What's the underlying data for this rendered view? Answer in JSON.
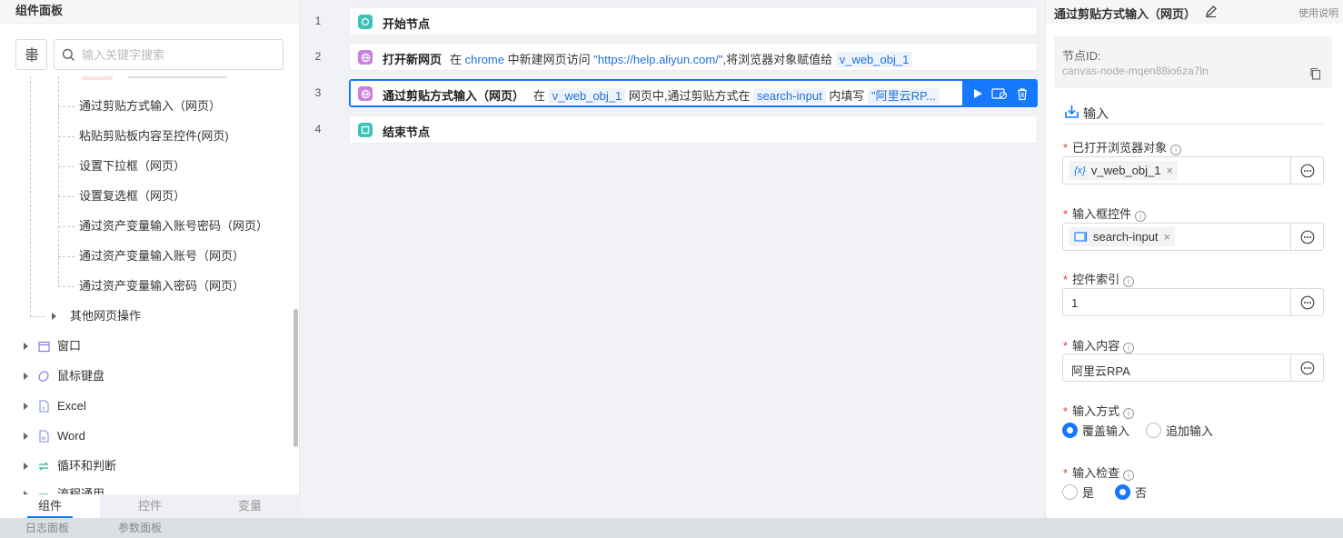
{
  "left_panel": {
    "title": "组件面板",
    "search_placeholder": "输入关键字搜索",
    "items": [
      "通过剪贴方式输入（网页）",
      "粘贴剪贴板内容至控件(网页)",
      "设置下拉框（网页）",
      "设置复选框（网页）",
      "通过资产变量输入账号密码（网页）",
      "通过资产变量输入账号（网页）",
      "通过资产变量输入密码（网页）"
    ],
    "sub_group": "其他网页操作",
    "categories": [
      "窗口",
      "鼠标键盘",
      "Excel",
      "Word",
      "循环和判断",
      "流程通用"
    ],
    "tabs": [
      "组件",
      "控件",
      "变量"
    ]
  },
  "bottom_tabs": [
    "日志面板",
    "参数面板"
  ],
  "canvas": {
    "rows": [
      {
        "num": "1",
        "title": "开始节点"
      },
      {
        "num": "2",
        "title": "打开新网页",
        "d1": "在",
        "browser": "chrome",
        "d2": "中新建网页访问",
        "url": "\"https://help.aliyun.com/\"",
        "d3": ",将浏览器对象赋值给",
        "var": "v_web_obj_1"
      },
      {
        "num": "3",
        "title": "通过剪贴方式输入（网页）",
        "d1": "在",
        "var": "v_web_obj_1",
        "d2": "网页中,通过剪贴方式在",
        "control": "search-input",
        "d3": "内填写",
        "content": "\"阿里云RP..."
      },
      {
        "num": "4",
        "title": "结束节点"
      }
    ]
  },
  "right_panel": {
    "title": "通过剪贴方式输入（网页）",
    "help": "使用说明",
    "node_id_label": "节点ID:",
    "node_id": "canvas-node-mqen88io6za7ln",
    "section": "输入",
    "fields": {
      "browser_label": "已打开浏览器对象",
      "browser_value": "v_web_obj_1",
      "control_label": "输入框控件",
      "control_value": "search-input",
      "index_label": "控件索引",
      "index_value": "1",
      "content_label": "输入内容",
      "content_value": "阿里云RPA",
      "mode_label": "输入方式",
      "mode_options": [
        "覆盖输入",
        "追加输入"
      ],
      "check_label": "输入检查",
      "check_options": [
        "是",
        "否"
      ]
    }
  },
  "colors": {
    "accent": "#1677ff",
    "start_node": "#3cc5b7",
    "web_node": "#c97fe0",
    "end_node": "#3cc5b7"
  }
}
